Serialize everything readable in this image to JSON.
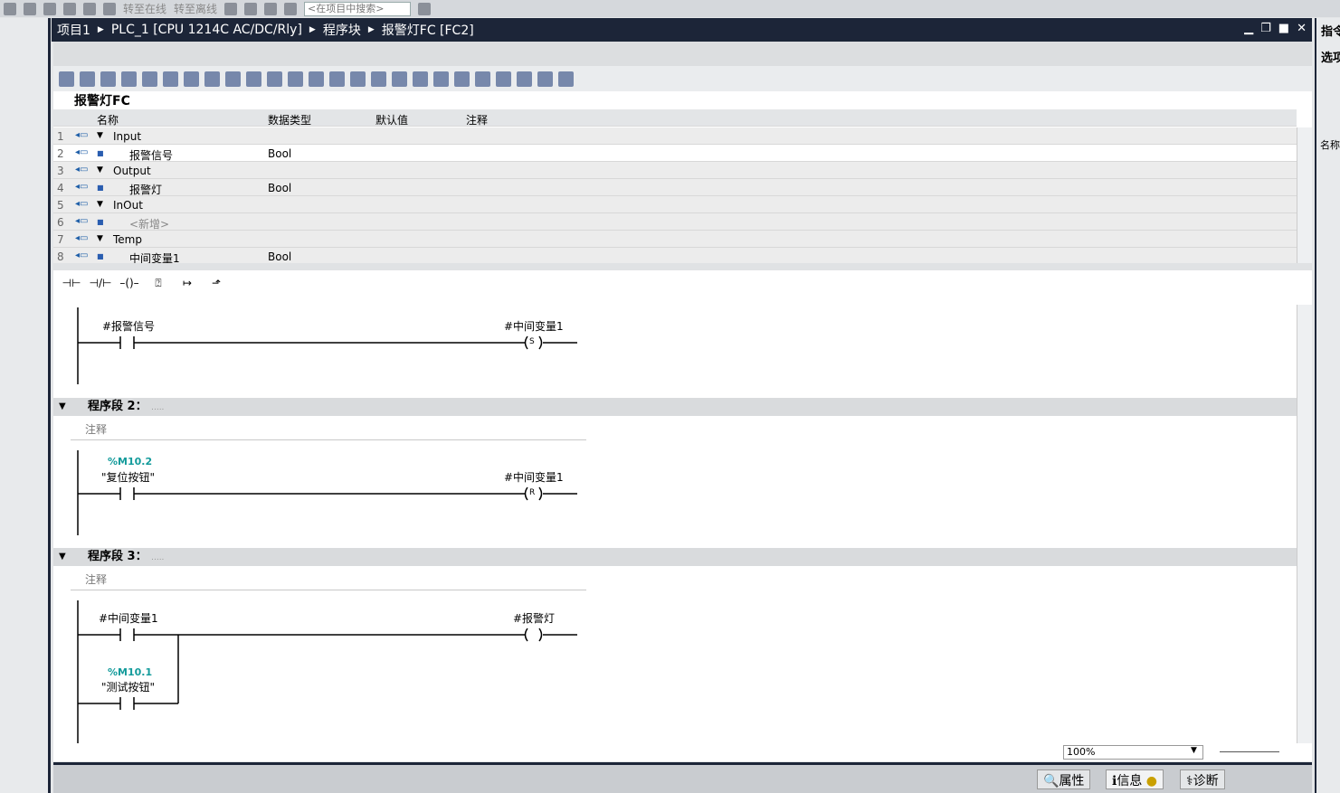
{
  "topbar": {
    "go_online": "转至在线",
    "go_offline": "转至离线",
    "search_placeholder": "<在项目中搜索>"
  },
  "breadcrumb": [
    "项目1",
    "PLC_1 [CPU 1214C AC/DC/Rly]",
    "程序块",
    "报警灯FC [FC2]"
  ],
  "block_title": "报警灯FC",
  "interface": {
    "headers": [
      "名称",
      "数据类型",
      "默认值",
      "注释"
    ],
    "rows": [
      {
        "num": "1",
        "name": "Input",
        "type": "",
        "section": true
      },
      {
        "num": "2",
        "name": "报警信号",
        "type": "Bool",
        "section": false
      },
      {
        "num": "3",
        "name": "Output",
        "type": "",
        "section": true
      },
      {
        "num": "4",
        "name": "报警灯",
        "type": "Bool",
        "section": false
      },
      {
        "num": "5",
        "name": "InOut",
        "type": "",
        "section": true
      },
      {
        "num": "6",
        "name": "<新增>",
        "type": "",
        "section": false
      },
      {
        "num": "7",
        "name": "Temp",
        "type": "",
        "section": true
      },
      {
        "num": "8",
        "name": "中间变量1",
        "type": "Bool",
        "section": false
      }
    ]
  },
  "networks": [
    {
      "title": "",
      "contact": "#报警信号",
      "coil": "#中间变量1",
      "coil_type": "S"
    },
    {
      "title": "程序段 2：",
      "dots": ".....",
      "comment": "注释",
      "address": "%M10.2",
      "contact": "\"复位按钮\"",
      "coil": "#中间变量1",
      "coil_type": "R"
    },
    {
      "title": "程序段 3：",
      "dots": ".....",
      "comment": "注释",
      "contact": "#中间变量1",
      "coil": "#报警灯",
      "coil_type": "",
      "branch_address": "%M10.1",
      "branch_contact": "\"测试按钮\""
    }
  ],
  "zoom": "100%",
  "bottom_tabs": [
    "属性",
    "信息",
    "诊断"
  ],
  "right_panel": {
    "tab1": "指令",
    "tab2": "选项",
    "col": "名称"
  }
}
